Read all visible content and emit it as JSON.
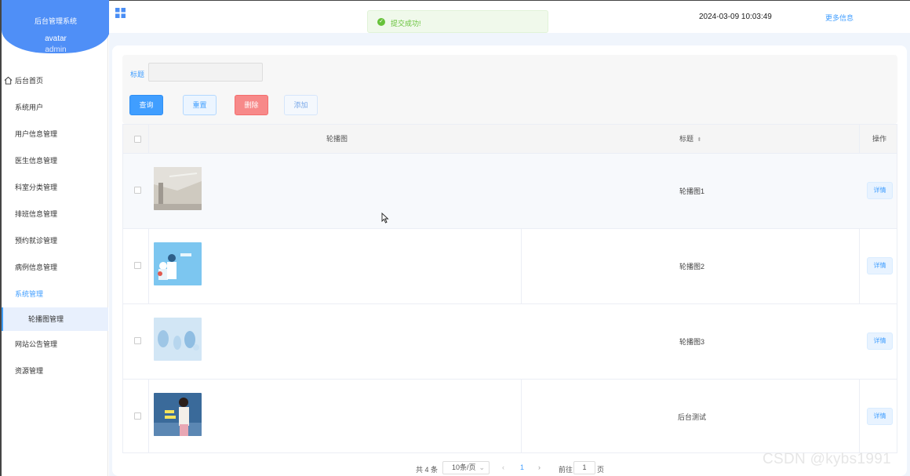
{
  "sidebar": {
    "brand_title": "后台管理系统",
    "avatar_alt": "avatar",
    "username": "admin",
    "items": [
      {
        "label": "后台首页",
        "icon": "home-icon"
      },
      {
        "label": "系统用户"
      },
      {
        "label": "用户信息管理"
      },
      {
        "label": "医生信息管理"
      },
      {
        "label": "科室分类管理"
      },
      {
        "label": "排班信息管理"
      },
      {
        "label": "预约就诊管理"
      },
      {
        "label": "病例信息管理"
      },
      {
        "label": "系统管理"
      },
      {
        "label": "轮播图管理"
      },
      {
        "label": "网站公告管理"
      },
      {
        "label": "资源管理"
      }
    ]
  },
  "topbar": {
    "datetime": "2024-03-09 10:03:49",
    "more": "更多信息"
  },
  "toast": {
    "message": "提交成功!"
  },
  "filter": {
    "title_label": "标题",
    "title_value": "",
    "query": "查询",
    "reset": "重置",
    "delete": "删除",
    "add": "添加"
  },
  "table": {
    "headers": {
      "image": "轮播图",
      "title": "标题",
      "actions": "操作"
    },
    "rows": [
      {
        "title": "轮播图1",
        "detail": "详情"
      },
      {
        "title": "轮播图2",
        "detail": "详情"
      },
      {
        "title": "轮播图3",
        "detail": "详情"
      },
      {
        "title": "后台测试",
        "detail": "详情"
      }
    ]
  },
  "pagination": {
    "total": "共 4 条",
    "page_size": "10条/页",
    "current": "1",
    "goto_prefix": "前往",
    "goto_value": "1",
    "goto_suffix": "页"
  },
  "watermark": "CSDN @kybs1991",
  "colors": {
    "primary": "#409eff",
    "danger": "#f78989",
    "brand": "#4f8ff7",
    "success": "#67c23a"
  }
}
